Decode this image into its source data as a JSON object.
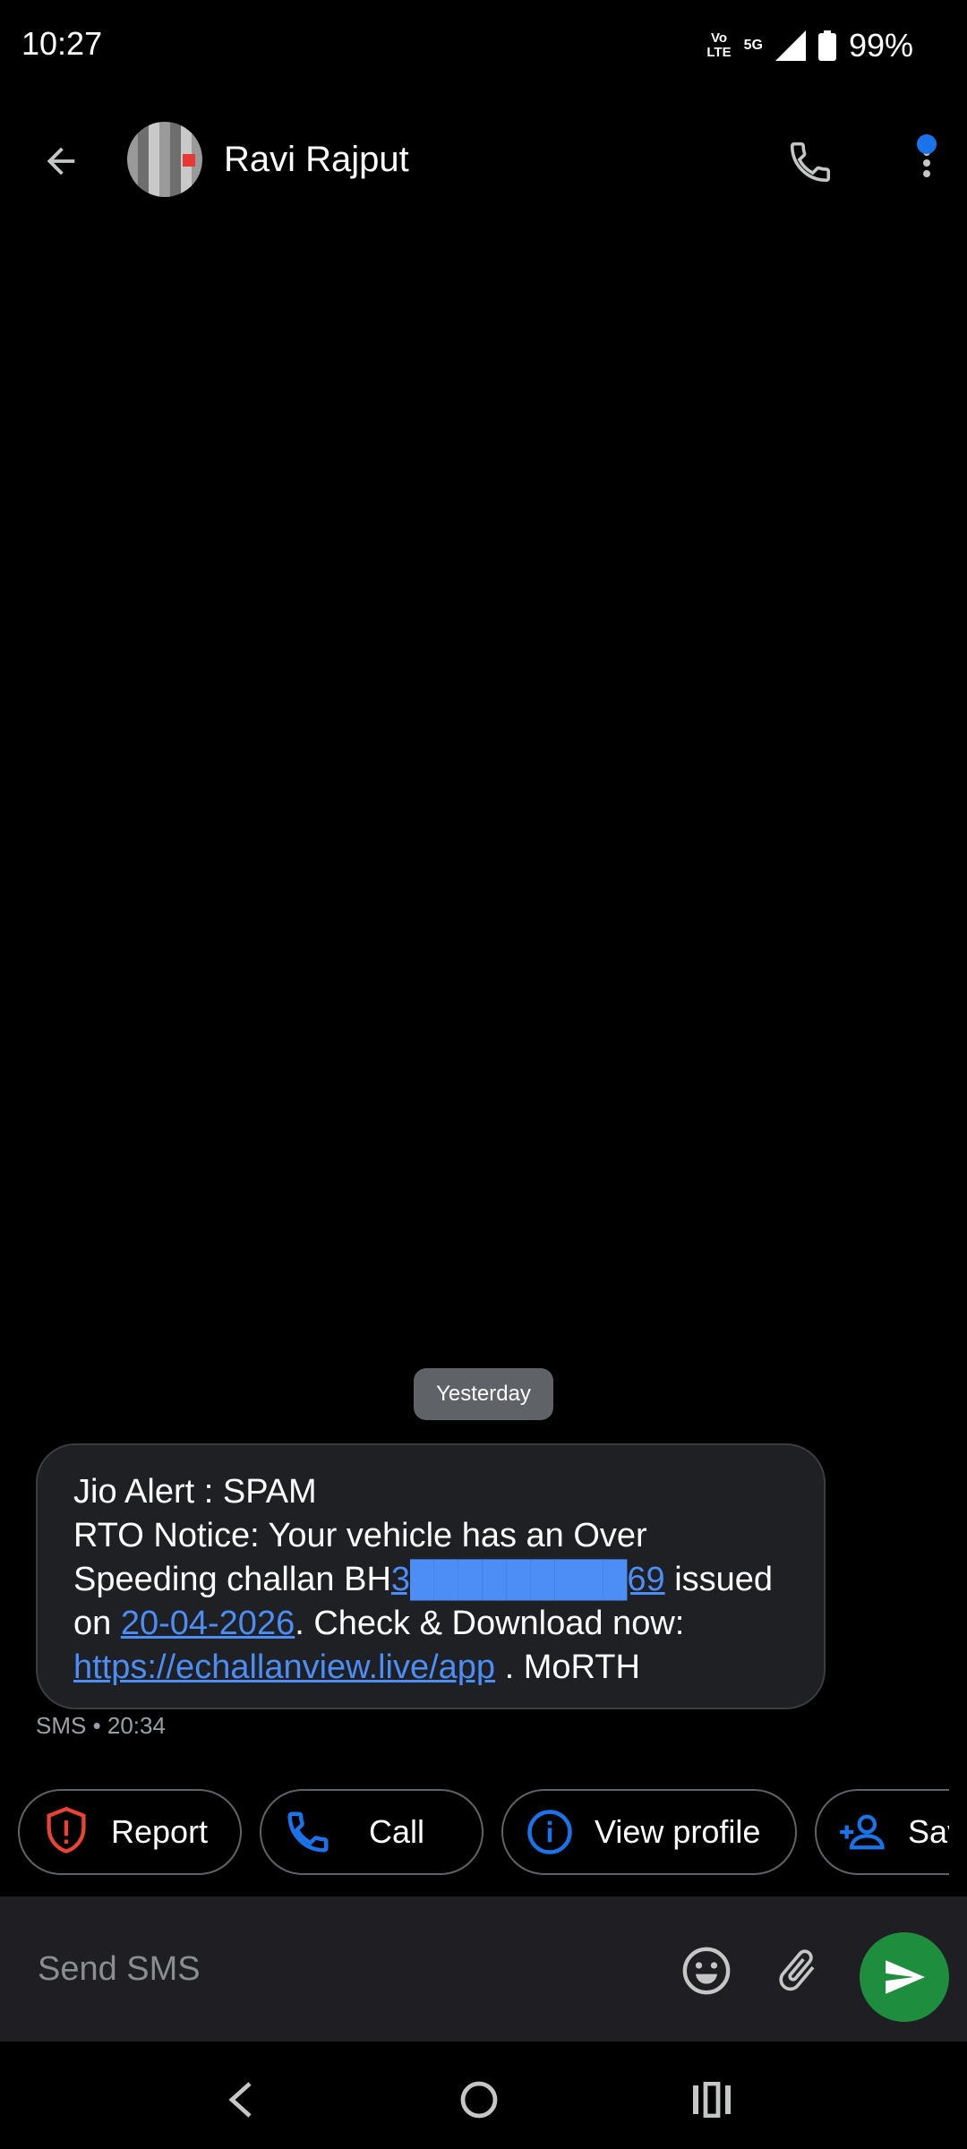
{
  "status_bar": {
    "time": "10:27",
    "volte_label_line1": "Vo",
    "volte_label_line2": "LTE",
    "network_label": "5G",
    "battery_percent": "99%"
  },
  "header": {
    "contact_name": "Ravi Rajput",
    "has_unread_indicator": true,
    "accent_color": "#1a73e8"
  },
  "conversation": {
    "date_separator": "Yesterday",
    "message": {
      "line1": "Jio Alert : SPAM",
      "text_part1": "RTO Notice: Your vehicle has an Over Speeding challan BH",
      "link_vehicle_number": "3█████████69",
      "text_part2": " issued on ",
      "link_date": "20-04-2026",
      "text_part3": ". Check & Download now: ",
      "link_url": "https://echallanview.live/app",
      "text_part4": " . MoRTH"
    },
    "meta": "SMS • 20:34"
  },
  "suggestions": [
    {
      "label": "Report",
      "icon": "shield-alert-icon",
      "color": "#ea4335"
    },
    {
      "label": "Call",
      "icon": "phone-icon",
      "color": "#1a73e8"
    },
    {
      "label": "View profile",
      "icon": "info-icon",
      "color": "#1a73e8"
    },
    {
      "label": "Save",
      "icon": "add-person-icon",
      "color": "#1a73e8"
    }
  ],
  "compose": {
    "placeholder": "Send SMS",
    "send_color": "#1e8e3e"
  },
  "nav_bar": {
    "buttons": [
      "back-icon",
      "home-icon",
      "recents-icon"
    ]
  }
}
